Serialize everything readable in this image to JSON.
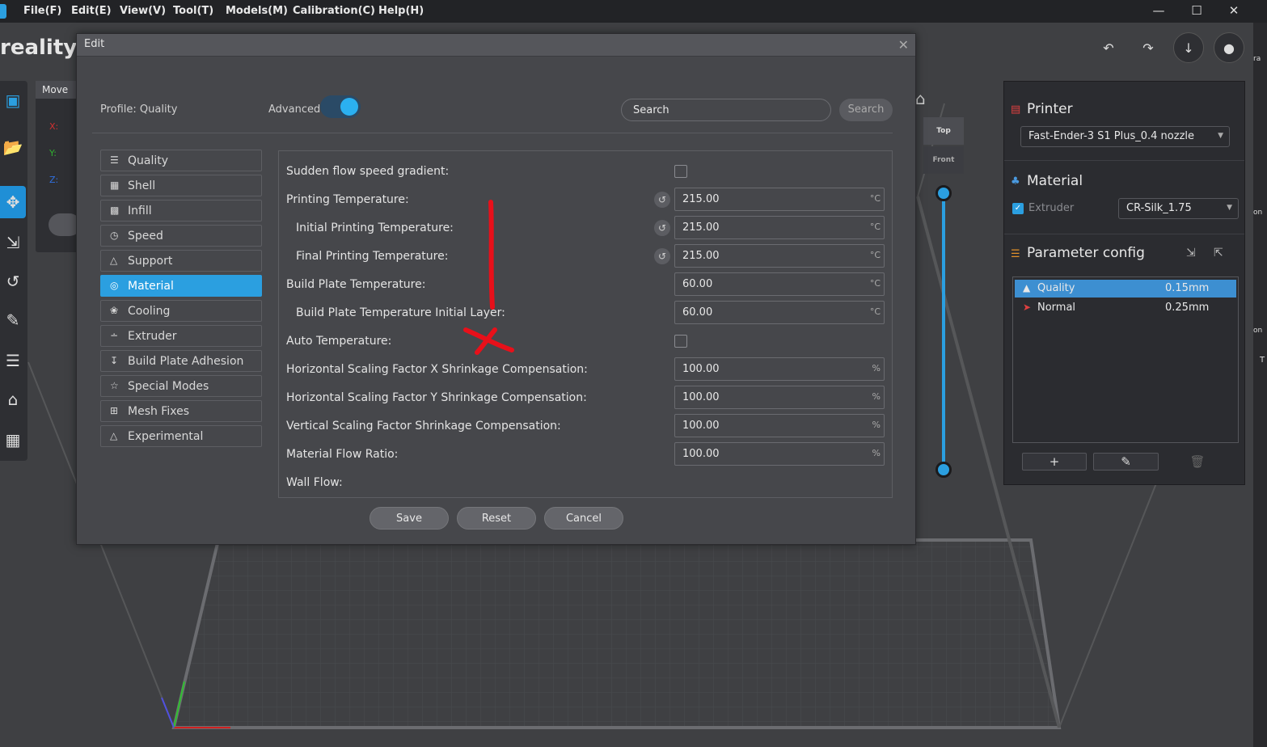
{
  "menubar": {
    "items": [
      "File(F)",
      "Edit(E)",
      "View(V)",
      "Tool(T)",
      "Models(M)",
      "Calibration(C)",
      "Help(H)"
    ]
  },
  "workspace": {
    "title": "reality_F",
    "move_panel_title": "Move",
    "axis_labels": [
      "X:",
      "Y:",
      "Z:"
    ],
    "view_buttons": [
      "Top",
      "Front"
    ]
  },
  "dialog": {
    "title": "Edit",
    "profile_label": "Profile:  Quality",
    "advanced_label": "Advanced",
    "advanced_on": true,
    "search_value": "Search",
    "search_button": "Search",
    "categories": [
      {
        "label": "Quality",
        "icon": "quality-icon"
      },
      {
        "label": "Shell",
        "icon": "shell-icon"
      },
      {
        "label": "Infill",
        "icon": "infill-icon"
      },
      {
        "label": "Speed",
        "icon": "speed-icon"
      },
      {
        "label": "Support",
        "icon": "support-icon"
      },
      {
        "label": "Material",
        "icon": "material-icon",
        "active": true
      },
      {
        "label": "Cooling",
        "icon": "cooling-icon"
      },
      {
        "label": "Extruder",
        "icon": "extruder-icon"
      },
      {
        "label": "Build Plate Adhesion",
        "icon": "adhesion-icon"
      },
      {
        "label": "Special Modes",
        "icon": "special-modes-icon"
      },
      {
        "label": "Mesh Fixes",
        "icon": "mesh-fixes-icon"
      },
      {
        "label": "Experimental",
        "icon": "experimental-icon"
      }
    ],
    "params": [
      {
        "label": "Sudden flow speed gradient:",
        "type": "checkbox",
        "indent": false
      },
      {
        "label": "Printing Temperature:",
        "type": "value",
        "value": "215.00",
        "unit": "°C",
        "reset": true,
        "indent": false
      },
      {
        "label": "Initial Printing Temperature:",
        "type": "value",
        "value": "215.00",
        "unit": "°C",
        "reset": true,
        "indent": true
      },
      {
        "label": "Final Printing Temperature:",
        "type": "value",
        "value": "215.00",
        "unit": "°C",
        "reset": true,
        "indent": true
      },
      {
        "label": "Build Plate Temperature:",
        "type": "value",
        "value": "60.00",
        "unit": "°C",
        "indent": false
      },
      {
        "label": "Build Plate Temperature Initial Layer:",
        "type": "value",
        "value": "60.00",
        "unit": "°C",
        "indent": true
      },
      {
        "label": "Auto Temperature:",
        "type": "checkbox",
        "indent": false
      },
      {
        "label": "Horizontal Scaling Factor X Shrinkage Compensation:",
        "type": "value",
        "value": "100.00",
        "unit": "%",
        "indent": false
      },
      {
        "label": "Horizontal Scaling Factor Y Shrinkage Compensation:",
        "type": "value",
        "value": "100.00",
        "unit": "%",
        "indent": false
      },
      {
        "label": "Vertical Scaling Factor Shrinkage Compensation:",
        "type": "value",
        "value": "100.00",
        "unit": "%",
        "indent": false
      },
      {
        "label": "Material Flow Ratio:",
        "type": "value",
        "value": "100.00",
        "unit": "%",
        "indent": false
      },
      {
        "label": "Wall Flow:",
        "type": "label",
        "indent": false
      }
    ],
    "buttons": {
      "save": "Save",
      "reset": "Reset",
      "cancel": "Cancel"
    }
  },
  "right_panel": {
    "printer_title": "Printer",
    "printer_select": "Fast-Ender-3 S1 Plus_0.4 nozzle",
    "material_title": "Material",
    "extruder_label": "Extruder",
    "material_select": "CR-Silk_1.75",
    "param_config_title": "Parameter config",
    "profiles": [
      {
        "name": "Quality",
        "value": "0.15mm",
        "selected": true
      },
      {
        "name": "Normal",
        "value": "0.25mm",
        "selected": false
      }
    ]
  },
  "edge_text": [
    "ra",
    "on",
    "on",
    "T"
  ],
  "colors": {
    "accent": "#2b9fe0",
    "annotation": "#e8101a"
  }
}
